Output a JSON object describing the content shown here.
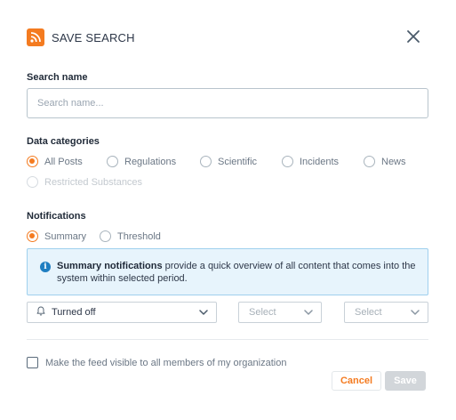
{
  "header": {
    "icon": "rss-feed-icon",
    "title": "SAVE SEARCH",
    "close_icon": "close-icon"
  },
  "search": {
    "label": "Search name",
    "placeholder": "Search name...",
    "value": ""
  },
  "categories": {
    "label": "Data categories",
    "options": [
      {
        "label": "All Posts",
        "checked": true,
        "disabled": false
      },
      {
        "label": "Regulations",
        "checked": false,
        "disabled": false
      },
      {
        "label": "Scientific",
        "checked": false,
        "disabled": false
      },
      {
        "label": "Incidents",
        "checked": false,
        "disabled": false
      },
      {
        "label": "News",
        "checked": false,
        "disabled": false
      },
      {
        "label": "Restricted Substances",
        "checked": false,
        "disabled": true
      }
    ]
  },
  "notifications": {
    "label": "Notifications",
    "options": [
      {
        "label": "Summary",
        "checked": true
      },
      {
        "label": "Threshold",
        "checked": false
      }
    ],
    "info": {
      "icon": "info-icon",
      "bold": "Summary notifications",
      "text": " provide a quick overview of all content that comes into the system within selected period."
    },
    "frequency": {
      "icon": "bell-icon",
      "value": "Turned off"
    },
    "select_a": {
      "placeholder": "Select"
    },
    "select_b": {
      "placeholder": "Select"
    }
  },
  "visibility": {
    "label": "Make the feed visible to all members of my organization",
    "checked": false
  },
  "actions": {
    "cancel": "Cancel",
    "save": "Save"
  },
  "colors": {
    "accent": "#f47b20",
    "info_bg": "#e7f4fc",
    "info_border": "#9fd0ee",
    "disabled_button": "#d2d6da"
  }
}
